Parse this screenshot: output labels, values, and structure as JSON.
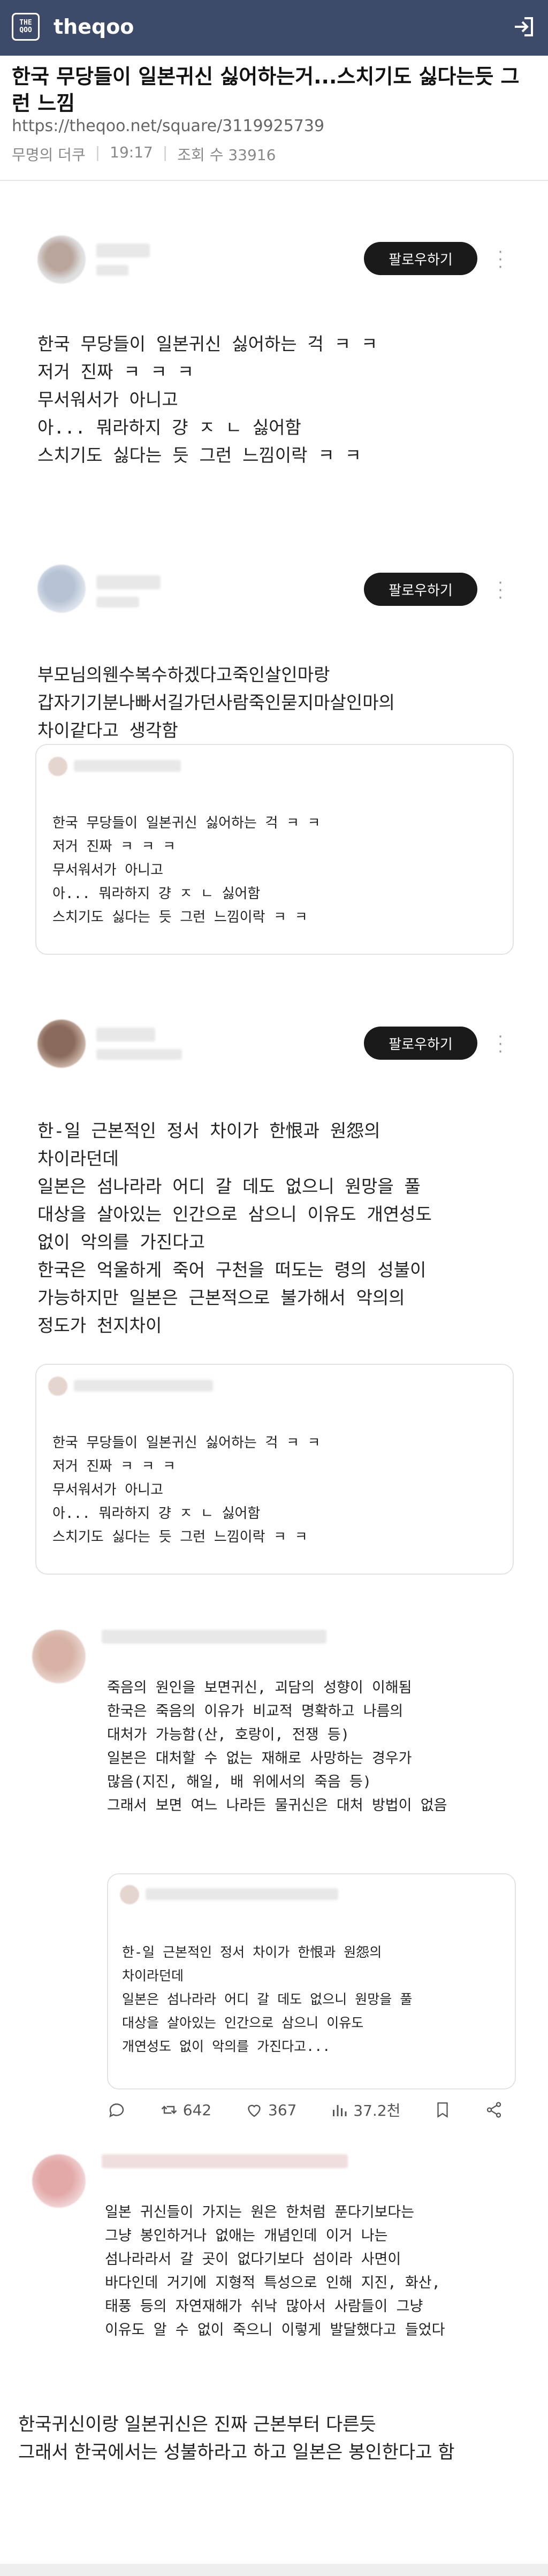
{
  "header": {
    "logo_text": "THE\nQOO",
    "brand": "theqoo",
    "login_icon": "login-icon"
  },
  "post": {
    "title": "한국 무당들이 일본귀신 싫어하는거...스치기도 싫다는듯 그런 느낌",
    "url": "https://theqoo.net/square/3119925739",
    "author": "무명의 더쿠",
    "time": "19:17",
    "views": "조회 수 33916"
  },
  "follow_label": "팔로우하기",
  "tweet1": {
    "lines": [
      "한국 무당들이 일본귀신 싫어하는 걱 ㅋ ㅋ",
      "저거 진짜 ㅋ ㅋ ㅋ",
      "무서워서가 아니고",
      "아... 뭐라하지 걍 ㅈ ㄴ 싫어함",
      "스치기도 싫다는 듯 그런 느낌이락 ㅋ ㅋ"
    ]
  },
  "tweet2": {
    "lines": [
      "부모님의웬수복수하겠다고죽인살인마랑",
      "갑자기기분나빠서길가던사람죽인묻지마살인마의",
      "차이같다고 생각함"
    ],
    "quote_lines": [
      "한국 무당들이 일본귀신 싫어하는 걱 ㅋ ㅋ",
      "저거 진짜 ㅋ ㅋ ㅋ",
      "무서워서가 아니고",
      "아... 뭐라하지 걍 ㅈ ㄴ 싫어함",
      "스치기도 싫다는 듯 그런 느낌이락 ㅋ ㅋ"
    ]
  },
  "tweet3": {
    "lines": [
      "한-일 근본적인 정서 차이가 한恨과 원怨의",
      "차이라던데",
      "일본은 섬나라라 어디 갈 데도 없으니 원망을 풀",
      "대상을 살아있는 인간으로 삼으니 이유도 개연성도",
      "없이 악의를 가진다고",
      "한국은 억울하게 죽어 구천을 떠도는 령의 성불이",
      "가능하지만 일본은 근본적으로 불가해서 악의의",
      "정도가 천지차이"
    ],
    "quote_lines": [
      "한국 무당들이 일본귀신 싫어하는 걱 ㅋ ㅋ",
      "저거 진짜 ㅋ ㅋ ㅋ",
      "무서워서가 아니고",
      "아... 뭐라하지 걍 ㅈ ㄴ 싫어함",
      "스치기도 싫다는 듯 그런 느낌이락 ㅋ ㅋ"
    ]
  },
  "tweet4": {
    "lines": [
      "죽음의 원인을 보면귀신, 괴담의 성향이 이해됨",
      "한국은 죽음의 이유가 비교적 명확하고 나름의",
      "대처가 가능함(산, 호랑이, 전쟁 등)",
      "일본은 대처할 수 없는 재해로 사망하는 경우가",
      "많음(지진, 해일, 배 위에서의 죽음 등)",
      "그래서 보면 여느 나라든 물귀신은 대처 방법이 없음"
    ],
    "quote_lines": [
      "한-일 근본적인 정서 차이가 한恨과 원怨의",
      "차이라던데",
      "일본은 섬나라라 어디 갈 데도 없으니 원망을 풀",
      "대상을 살아있는 인간으로 삼으니 이유도",
      "개연성도 없이 악의를 가진다고..."
    ],
    "stats": {
      "retweets": "642",
      "likes": "367",
      "views": "37.2천"
    }
  },
  "tweet5": {
    "lines": [
      "일본 귀신들이 가지는 원은 한처럼 푼다기보다는",
      "그냥 봉인하거나 없애는 개념인데 이거 나는",
      "섬나라라서 갈 곳이 없다기보다 섬이라 사면이",
      "바다인데 거기에 지형적 특성으로 인해 지진, 화산,",
      "태풍 등의 자연재해가 쉬낙 많아서 사람들이 그냥",
      "이유도 알 수 없이 죽으니 이렇게 발달했다고 들었다"
    ]
  },
  "bottom_text": [
    "한국귀신이랑 일본귀신은 진짜 근본부터 다른듯",
    "그래서 한국에서는 성불하라고 하고 일본은 봉인한다고 함"
  ]
}
